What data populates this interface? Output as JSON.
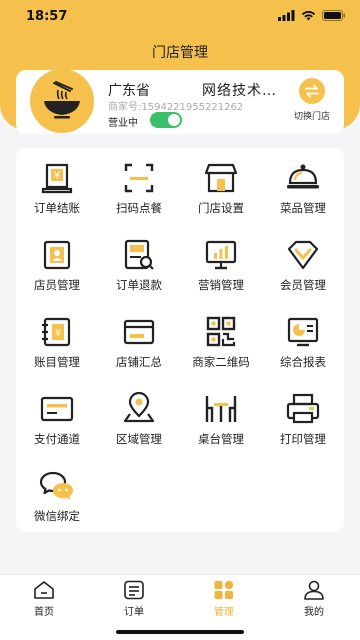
{
  "status_bar": {
    "time": "18:57"
  },
  "header": {
    "title": "门店管理"
  },
  "store": {
    "province": "广东省",
    "name": "网络技术…",
    "merchant_id": "商家号:1594221955221262",
    "status_label": "营业中",
    "open": true,
    "switch_label": "切换门店"
  },
  "menu": [
    {
      "label": "订单结账",
      "icon": "order-checkout-icon"
    },
    {
      "label": "扫码点餐",
      "icon": "scan-order-icon"
    },
    {
      "label": "门店设置",
      "icon": "store-settings-icon"
    },
    {
      "label": "菜品管理",
      "icon": "dish-management-icon"
    },
    {
      "label": "店员管理",
      "icon": "staff-management-icon"
    },
    {
      "label": "订单退款",
      "icon": "order-refund-icon"
    },
    {
      "label": "营销管理",
      "icon": "marketing-icon"
    },
    {
      "label": "会员管理",
      "icon": "member-icon"
    },
    {
      "label": "账目管理",
      "icon": "accounts-icon"
    },
    {
      "label": "店铺汇总",
      "icon": "store-summary-icon"
    },
    {
      "label": "商家二维码",
      "icon": "qrcode-icon"
    },
    {
      "label": "综合报表",
      "icon": "report-icon"
    },
    {
      "label": "支付通道",
      "icon": "payment-channel-icon"
    },
    {
      "label": "区域管理",
      "icon": "area-icon"
    },
    {
      "label": "桌台管理",
      "icon": "table-icon"
    },
    {
      "label": "打印管理",
      "icon": "printer-icon"
    },
    {
      "label": "微信绑定",
      "icon": "wechat-icon"
    }
  ],
  "tabbar": [
    {
      "label": "首页",
      "icon": "home-icon",
      "active": false
    },
    {
      "label": "订单",
      "icon": "orders-icon",
      "active": false
    },
    {
      "label": "管理",
      "icon": "manage-icon",
      "active": true
    },
    {
      "label": "我的",
      "icon": "profile-icon",
      "active": false
    }
  ],
  "colors": {
    "accent": "#f5c04c",
    "toggle_on": "#3bbf6a",
    "active_tab": "#f0b53c"
  }
}
